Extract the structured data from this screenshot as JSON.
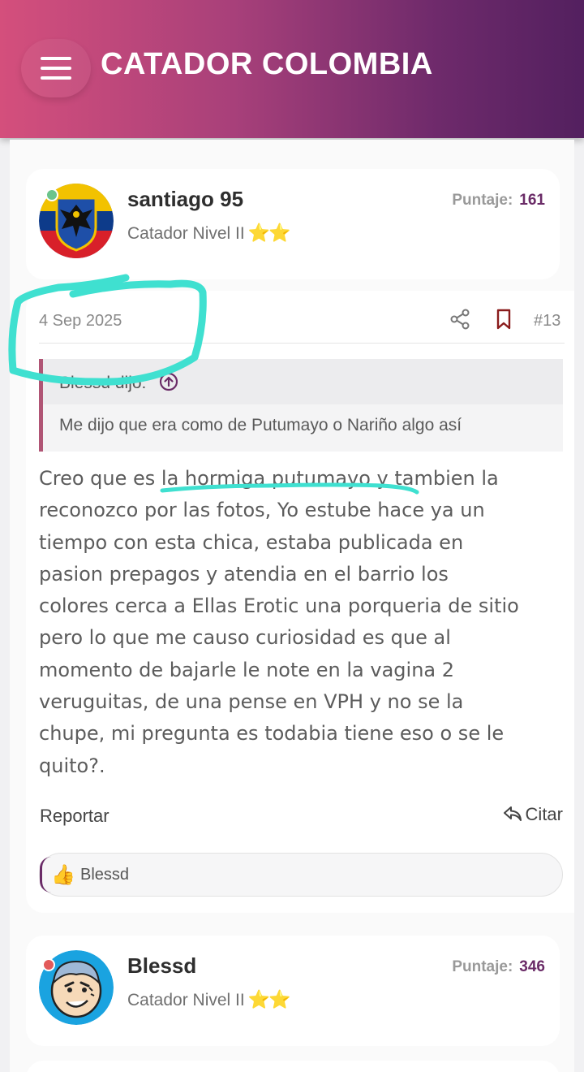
{
  "app": {
    "title": "CATADOR COLOMBIA"
  },
  "posts": [
    {
      "author": "santiago 95",
      "level": "Catador Nivel II",
      "stars": "⭐⭐",
      "score_label": "Puntaje:",
      "score": "161",
      "date": "4 Sep 2025",
      "number": "#13",
      "quote": {
        "author_line": "Blessd dijo:",
        "text": "Me dijo que era como de Putumayo o Nariño algo así"
      },
      "body_lines": [
        "Creo que es la hormiga putumayo y tambien la",
        "reconozco por las fotos, Yo estube hace ya un",
        "tiempo con esta chica, estaba publicada en",
        "pasion prepagos y atendia en el barrio los",
        "colores cerca a Ellas Erotic una porqueria de sitio",
        "pero lo que me causo curiosidad es que al",
        "momento de bajarle le note en la vagina 2",
        "veruguitas, de una pense en VPH y no se la",
        "chupe, mi pregunta es todabia tiene eso o se le",
        "quito?."
      ],
      "report_label": "Reportar",
      "quote_label": "Citar",
      "reaction_user": "Blessd"
    },
    {
      "author": "Blessd",
      "level": "Catador Nivel II",
      "stars": "⭐⭐",
      "score_label": "Puntaje:",
      "score": "346"
    }
  ],
  "colors": {
    "header_start": "#d44f7c",
    "header_end": "#53205f",
    "accent": "#6a2b67",
    "annotation": "#3fe0d0"
  },
  "icons": {
    "menu": "hamburger-icon",
    "share": "share-icon",
    "bookmark": "bookmark-icon",
    "quote_up": "arrow-up-circle-icon",
    "reply": "reply-icon",
    "reaction": "thumbs-up-icon"
  }
}
